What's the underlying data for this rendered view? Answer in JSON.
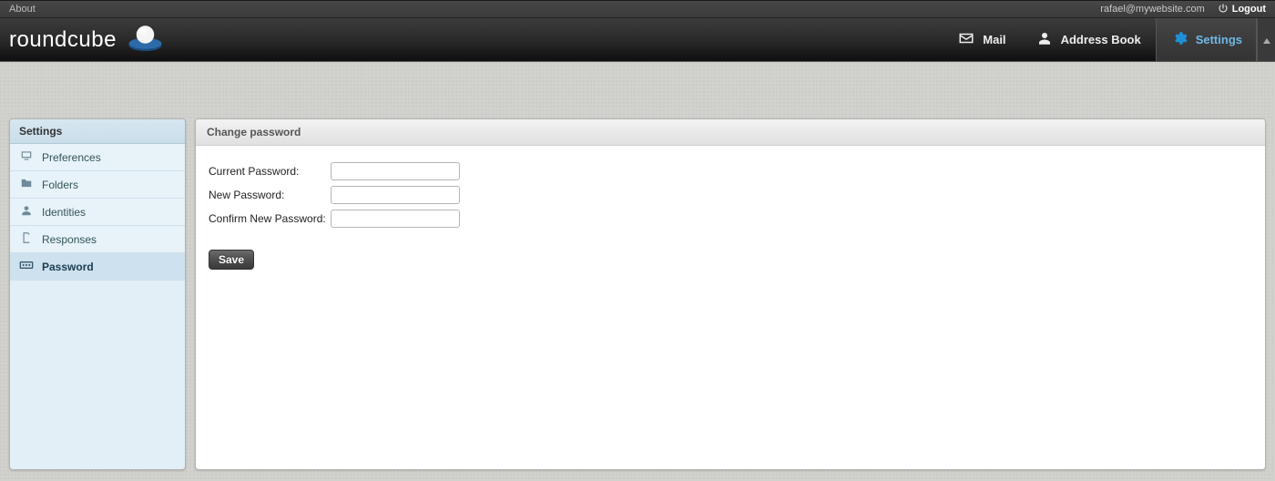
{
  "topbar": {
    "about": "About",
    "user_email": "rafael@mywebsite.com",
    "logout": "Logout"
  },
  "brand": {
    "name_part1": "round",
    "name_part2": "cube"
  },
  "nav": {
    "mail": "Mail",
    "addressbook": "Address Book",
    "settings": "Settings"
  },
  "sidebar": {
    "header": "Settings",
    "items": [
      {
        "label": "Preferences",
        "icon": "monitor-icon",
        "selected": false
      },
      {
        "label": "Folders",
        "icon": "folder-icon",
        "selected": false
      },
      {
        "label": "Identities",
        "icon": "person-icon",
        "selected": false
      },
      {
        "label": "Responses",
        "icon": "document-icon",
        "selected": false
      },
      {
        "label": "Password",
        "icon": "password-icon",
        "selected": true
      }
    ]
  },
  "panel": {
    "title": "Change password",
    "fields": {
      "current": "Current Password:",
      "new": "New Password:",
      "confirm": "Confirm New Password:"
    },
    "save": "Save"
  }
}
